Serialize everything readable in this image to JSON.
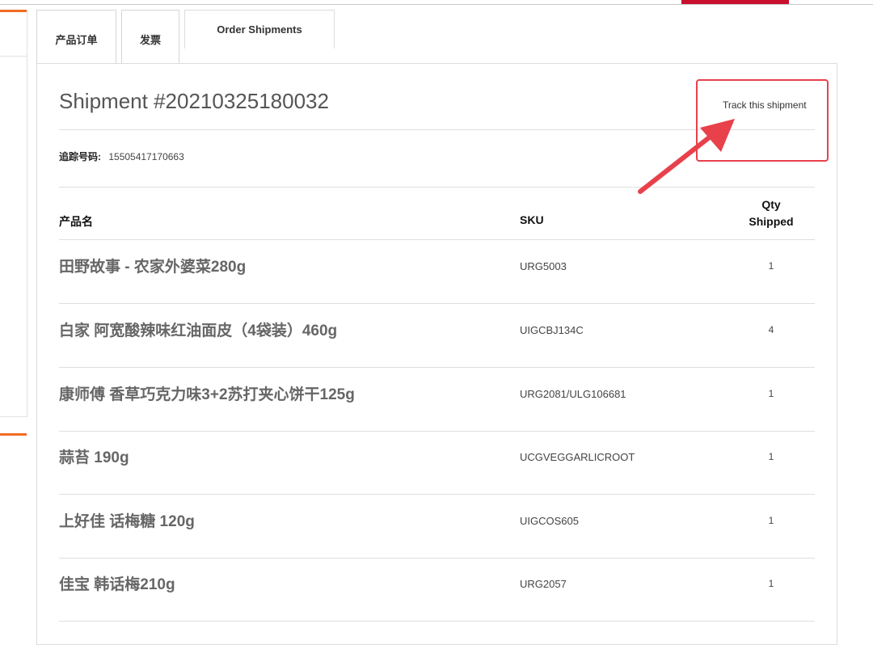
{
  "tabs": [
    {
      "label": "产品订单"
    },
    {
      "label": "发票"
    },
    {
      "label": "Order Shipments"
    }
  ],
  "shipment": {
    "title": "Shipment #20210325180032",
    "track_link": "Track this shipment",
    "tracking_label": "追踪号码:",
    "tracking_number": "15505417170663"
  },
  "table": {
    "headers": {
      "name": "产品名",
      "sku": "SKU",
      "qty_line1": "Qty",
      "qty_line2": "Shipped"
    },
    "rows": [
      {
        "name": "田野故事 - 农家外婆菜280g",
        "sku": "URG5003",
        "qty": "1"
      },
      {
        "name": "白家 阿宽酸辣味红油面皮（4袋装）460g",
        "sku": "UIGCBJ134C",
        "qty": "4"
      },
      {
        "name": "康师傅 香草巧克力味3+2苏打夹心饼干125g",
        "sku": "URG2081/ULG106681",
        "qty": "1"
      },
      {
        "name": "蒜苔 190g",
        "sku": "UCGVEGGARLICROOT",
        "qty": "1"
      },
      {
        "name": "上好佳 话梅糖 120g",
        "sku": "UIGCOS605",
        "qty": "1"
      },
      {
        "name": "佳宝 韩话梅210g",
        "sku": "URG2057",
        "qty": "1"
      }
    ]
  },
  "colors": {
    "accent_red": "#c8102e",
    "accent_orange": "#f26b22",
    "annotation_red": "#e8414c"
  }
}
